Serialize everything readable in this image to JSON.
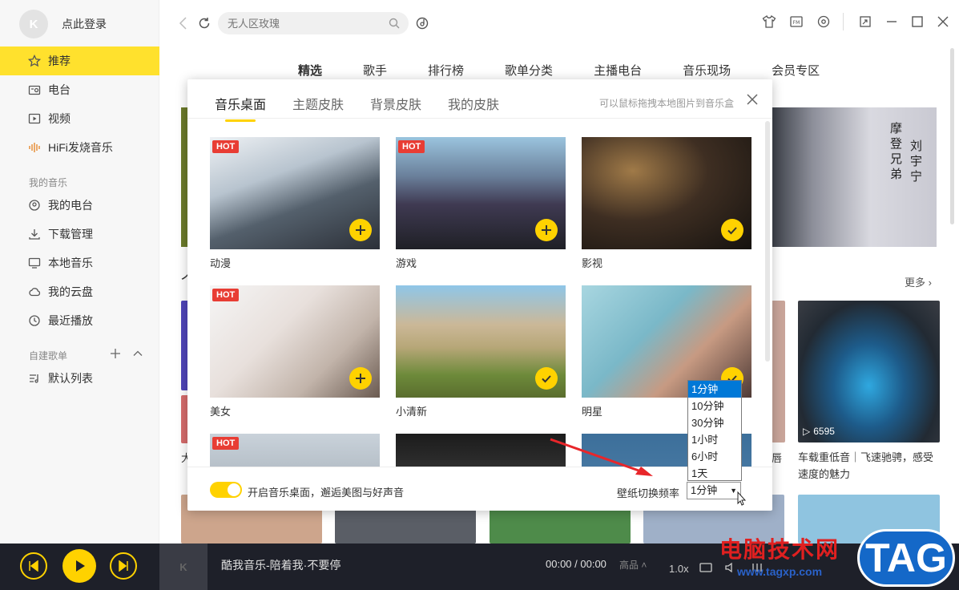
{
  "user": {
    "avatar_text": "K",
    "login_label": "点此登录"
  },
  "sidebar": {
    "items": [
      {
        "label": "推荐",
        "icon": "star-icon",
        "active": true
      },
      {
        "label": "电台",
        "icon": "radio-icon"
      },
      {
        "label": "视频",
        "icon": "video-icon"
      },
      {
        "label": "HiFi发烧音乐",
        "icon": "hifi-wave-icon"
      }
    ],
    "my_music_label": "我的音乐",
    "my_music": [
      {
        "label": "我的电台",
        "icon": "my-radio-icon"
      },
      {
        "label": "下载管理",
        "icon": "download-icon"
      },
      {
        "label": "本地音乐",
        "icon": "monitor-icon"
      },
      {
        "label": "我的云盘",
        "icon": "cloud-icon"
      },
      {
        "label": "最近播放",
        "icon": "clock-icon"
      }
    ],
    "playlists_label": "自建歌单",
    "playlists": [
      {
        "label": "默认列表",
        "icon": "playlist-icon"
      }
    ]
  },
  "search": {
    "placeholder": "无人区玫瑰"
  },
  "main_tabs": [
    "精选",
    "歌手",
    "排行榜",
    "歌单分类",
    "主播电台",
    "音乐现场",
    "会员专区"
  ],
  "banner": {
    "poem_a": "摩登兄弟",
    "poem_b": "刘宇宁"
  },
  "more_label": "更多",
  "car_card": {
    "play_count": "6595",
    "title": "车载重低音｜飞速驰骋，感受速度的魅力"
  },
  "left_card_fragment": "大",
  "right_card_fragment": "唇",
  "section_fragment": "个",
  "skin_dialog": {
    "tabs": [
      "音乐桌面",
      "主题皮肤",
      "背景皮肤",
      "我的皮肤"
    ],
    "hint": "可以鼠标拖拽本地图片到音乐盒",
    "hot_label": "HOT",
    "cards": [
      {
        "name": "动漫",
        "hot": true,
        "state": "add"
      },
      {
        "name": "游戏",
        "hot": true,
        "state": "add"
      },
      {
        "name": "影视",
        "hot": false,
        "state": "checked"
      },
      {
        "name": "美女",
        "hot": true,
        "state": "add"
      },
      {
        "name": "小清新",
        "hot": false,
        "state": "checked"
      },
      {
        "name": "明星",
        "hot": false,
        "state": "checked"
      },
      {
        "name": "",
        "hot": true,
        "state": "none"
      },
      {
        "name": "",
        "hot": false,
        "state": "none"
      },
      {
        "name": "",
        "hot": false,
        "state": "none"
      }
    ],
    "toggle_label": "开启音乐桌面，邂逅美图与好声音",
    "frequency_label": "壁纸切换频率",
    "frequency_value": "1分钟",
    "frequency_options": [
      "1分钟",
      "10分钟",
      "30分钟",
      "1小时",
      "6小时",
      "1天"
    ]
  },
  "player": {
    "song": "酷我音乐-陪着我·不要停",
    "time": "00:00 / 00:00",
    "quality": "高品",
    "speed": "1.0x",
    "cover_text": "K"
  },
  "watermark": {
    "site": "电脑技术网",
    "url": "www.tagxp.com",
    "tag": "TAG"
  },
  "colors": {
    "accent": "#ffd200",
    "sidebar_active": "#ffe12d",
    "hot": "#e83d34",
    "player_bg": "#1e2029"
  }
}
